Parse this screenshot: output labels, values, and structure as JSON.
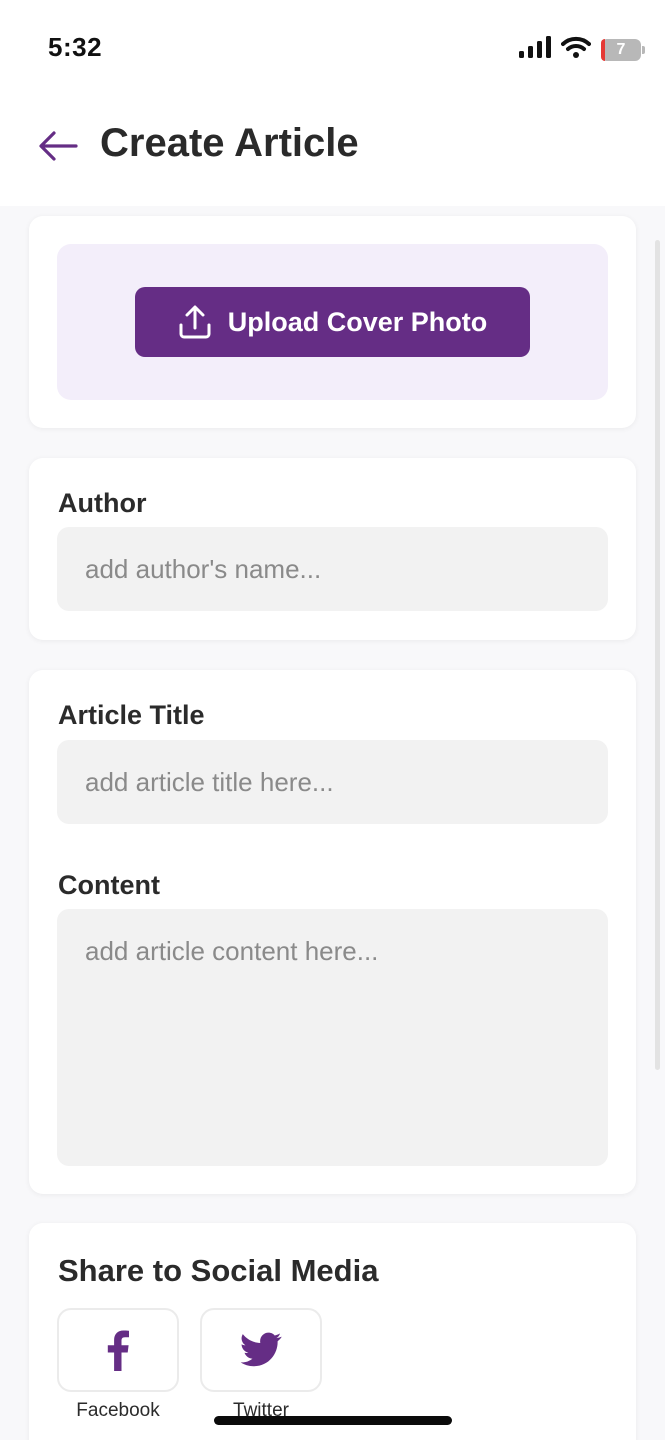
{
  "status_bar": {
    "time": "5:32",
    "battery_level": "7",
    "icons": [
      "signal-icon",
      "wifi-icon",
      "battery-icon"
    ]
  },
  "header": {
    "back_icon": "arrow-left-icon",
    "title": "Create Article"
  },
  "cover_upload": {
    "button_label": "Upload Cover Photo",
    "icon": "upload-icon"
  },
  "author": {
    "label": "Author",
    "placeholder": "add author's name...",
    "value": ""
  },
  "article": {
    "title_label": "Article Title",
    "title_placeholder": "add article title here...",
    "title_value": "",
    "content_label": "Content",
    "content_placeholder": "add article content here...",
    "content_value": ""
  },
  "social": {
    "heading": "Share to Social Media",
    "items": [
      {
        "label": "Facebook",
        "icon": "facebook-icon"
      },
      {
        "label": "Twitter",
        "icon": "twitter-icon"
      }
    ]
  },
  "colors": {
    "accent": "#652d85",
    "upload_zone_bg": "#f3eefa",
    "input_bg": "#f2f2f2",
    "battery_low": "#e53935"
  }
}
